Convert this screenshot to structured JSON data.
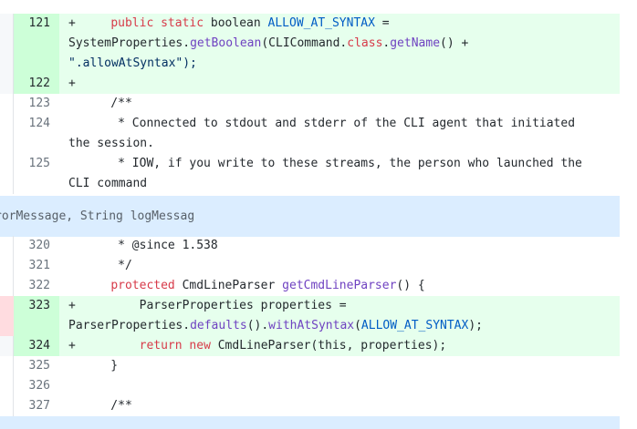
{
  "diff": {
    "rows": [
      {
        "ln": "121",
        "marker": "+",
        "kind": "add",
        "l1": [
          [
            "    ",
            ""
          ],
          [
            "public",
            "kw"
          ],
          [
            " ",
            ""
          ],
          [
            "static",
            "kw"
          ],
          [
            " boolean ",
            ""
          ],
          [
            "ALLOW_AT_SYNTAX",
            "c1"
          ],
          [
            " =",
            ""
          ]
        ],
        "l2": [
          [
            "SystemProperties.",
            ""
          ],
          [
            "getBoolean",
            "en"
          ],
          [
            "(CLICommand.",
            ""
          ],
          [
            "class",
            "kw"
          ],
          [
            ".",
            ""
          ],
          [
            "getName",
            "en"
          ],
          [
            "() +",
            ""
          ]
        ],
        "l3": [
          [
            "\".allowAtSyntax\");",
            "str"
          ]
        ]
      },
      {
        "ln": "122",
        "marker": "+",
        "kind": "add",
        "l1": []
      },
      {
        "ln": "123",
        "marker": "",
        "kind": "ctx",
        "l1": [
          [
            "    /**",
            ""
          ]
        ]
      },
      {
        "ln": "124",
        "marker": "",
        "kind": "ctx",
        "l1": [
          [
            "     * Connected to stdout and stderr of the CLI agent that initiated",
            ""
          ]
        ],
        "l2": [
          [
            "the session.",
            ""
          ]
        ]
      },
      {
        "ln": "125",
        "marker": "",
        "kind": "ctx",
        "l1": [
          [
            "     * IOW, if you write to these streams, the person who launched the",
            ""
          ]
        ],
        "l2": [
          [
            "CLI command",
            ""
          ]
        ]
      }
    ],
    "hunk_text": "rorMessage, String logMessag",
    "rows2": [
      {
        "ln": "320",
        "marker": "",
        "kind": "ctx",
        "l1": [
          [
            "     * @since 1.538",
            ""
          ]
        ]
      },
      {
        "ln": "321",
        "marker": "",
        "kind": "ctx",
        "l1": [
          [
            "     */",
            ""
          ]
        ]
      },
      {
        "ln": "322",
        "marker": "",
        "kind": "ctx",
        "l1": [
          [
            "    ",
            ""
          ],
          [
            "protected",
            "kw"
          ],
          [
            " CmdLineParser ",
            ""
          ],
          [
            "getCmdLineParser",
            "en"
          ],
          [
            "() {",
            ""
          ]
        ]
      },
      {
        "ln": "323",
        "marker": "+",
        "kind": "add",
        "l1": [
          [
            "        ParserProperties properties =",
            ""
          ]
        ],
        "l2": [
          [
            "ParserProperties.",
            ""
          ],
          [
            "defaults",
            "en"
          ],
          [
            "().",
            ""
          ],
          [
            "withAtSyntax",
            "en"
          ],
          [
            "(",
            ""
          ],
          [
            "ALLOW_AT_SYNTAX",
            "c1"
          ],
          [
            ");",
            ""
          ]
        ]
      },
      {
        "ln": "324",
        "marker": "+",
        "kind": "add",
        "l1": [
          [
            "        ",
            ""
          ],
          [
            "return",
            "kw"
          ],
          [
            " ",
            ""
          ],
          [
            "new",
            "kw"
          ],
          [
            " CmdLineParser(this, properties);",
            ""
          ]
        ]
      },
      {
        "ln": "325",
        "marker": "",
        "kind": "ctx",
        "l1": [
          [
            "    }",
            ""
          ]
        ]
      },
      {
        "ln": "326",
        "marker": "",
        "kind": "ctx",
        "l1": []
      },
      {
        "ln": "327",
        "marker": "",
        "kind": "ctx",
        "l1": [
          [
            "    /**",
            ""
          ]
        ]
      }
    ]
  }
}
